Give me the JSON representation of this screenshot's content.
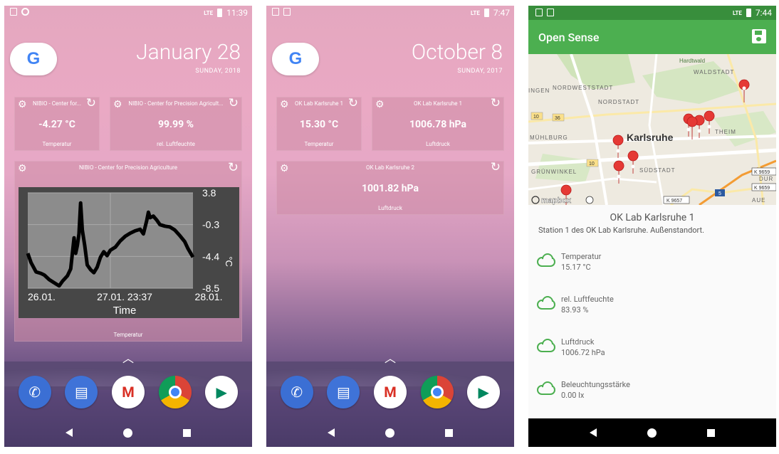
{
  "phone1": {
    "status": {
      "time": "11:39",
      "network": "LTE"
    },
    "date": "January 28",
    "day": "SUNDAY, 2018",
    "widgets": [
      {
        "title": "NIBIO - Center for...",
        "value": "-4.27 °C",
        "label": "Temperatur"
      },
      {
        "title": "NIBIO - Center for Precision Agricult...",
        "value": "99.99 %",
        "label": "rel. Luftfeuchte"
      }
    ],
    "chart_widget": {
      "title": "NIBIO - Center for Precision Agriculture",
      "label": "Temperatur"
    }
  },
  "phone2": {
    "status": {
      "time": "7:47",
      "network": "LTE"
    },
    "date": "October 8",
    "day": "SUNDAY, 2017",
    "widgets": [
      {
        "title": "OK Lab Karlsruhe 1",
        "value": "15.30 °C",
        "label": "Temperatur"
      },
      {
        "title": "OK Lab Karlsruhe 1",
        "value": "1006.78 hPa",
        "label": "Luftdruck"
      },
      {
        "title": "OK Lab Karlsruhe 2",
        "value": "1001.82 hPa",
        "label": "Luftdruck"
      }
    ]
  },
  "phone3": {
    "status": {
      "time": "7:44",
      "network": "LTE"
    },
    "app_title": "Open Sense",
    "map_labels": {
      "city": "Karlsruhe",
      "hardtwald": "Hardtwald",
      "waldstadt": "WALDSTADT",
      "nordweststadt": "NORDWESTSTADT",
      "nordstadt": "NORDSTADT",
      "muhlburg": "MÜHLBURG",
      "grunwinkel": "GRÜNWINKEL",
      "sudstadt": "SÜDSTADT",
      "theim": "THEIM",
      "ingen": "INGEN",
      "road36": "36",
      "road10": "10",
      "road10b": "10",
      "road5": "5",
      "k9657": "K 9657",
      "k9659": "K 9659",
      "k9659b": "K 9659",
      "dur": "DUR",
      "aue": "AUE",
      "mapbox": "mapbox"
    },
    "station": {
      "name": "OK Lab Karlsruhe 1",
      "description": "Station 1 des OK Lab Karlsruhe. Außenstandort."
    },
    "sensors": [
      {
        "name": "Temperatur",
        "value": "15.17 °C"
      },
      {
        "name": "rel. Luftfeuchte",
        "value": "83.93 %"
      },
      {
        "name": "Luftdruck",
        "value": "1006.72 hPa"
      },
      {
        "name": "Beleuchtungsstärke",
        "value": "0.00 lx"
      }
    ]
  },
  "chart_data": {
    "type": "line",
    "title": "",
    "xlabel": "Time",
    "ylabel": "°C",
    "x_ticks": [
      "26.01.",
      "27.01. 23:37",
      "28.01."
    ],
    "y_ticks": [
      3.8,
      -0.3,
      -4.4,
      -8.5
    ],
    "ylim": [
      -8.5,
      3.8
    ],
    "x": [
      0,
      0.02,
      0.05,
      0.08,
      0.1,
      0.13,
      0.16,
      0.19,
      0.21,
      0.24,
      0.26,
      0.28,
      0.29,
      0.3,
      0.31,
      0.32,
      0.33,
      0.345,
      0.36,
      0.38,
      0.4,
      0.42,
      0.44,
      0.46,
      0.48,
      0.5,
      0.53,
      0.56,
      0.59,
      0.62,
      0.65,
      0.68,
      0.7,
      0.72,
      0.73,
      0.74,
      0.76,
      0.78,
      0.8,
      0.83,
      0.86,
      0.89,
      0.92,
      0.95,
      0.97,
      1.0
    ],
    "values": [
      -4.0,
      -5.2,
      -6.4,
      -6.6,
      -6.8,
      -7.4,
      -7.8,
      -8.2,
      -7.6,
      -6.9,
      -6.0,
      -2.0,
      -4.0,
      -3.0,
      -1.5,
      2.5,
      -1.0,
      -3.0,
      -5.5,
      -6.1,
      -6.5,
      -5.8,
      -4.5,
      -3.8,
      -4.3,
      -3.6,
      -3.2,
      -2.4,
      -1.8,
      -1.4,
      -1.1,
      -0.9,
      -1.5,
      0.2,
      1.3,
      0.6,
      0.8,
      0.3,
      -0.3,
      -0.5,
      -0.6,
      -1.0,
      -1.7,
      -2.5,
      -3.4,
      -4.5
    ]
  }
}
